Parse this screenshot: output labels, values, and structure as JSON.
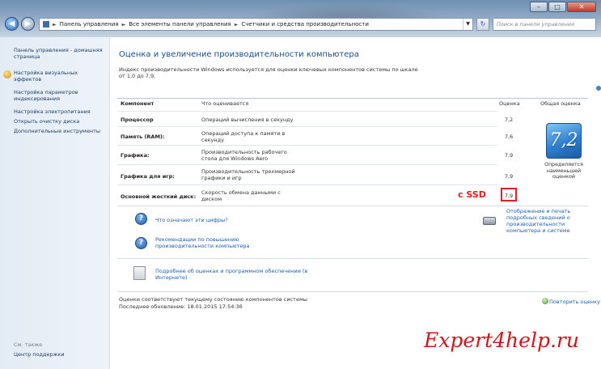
{
  "window": {
    "controls": {
      "minimize": "–",
      "maximize": "□",
      "close": "✕"
    }
  },
  "navigation": {
    "back_icon": "back-arrow-icon",
    "forward_icon": "forward-arrow-icon",
    "breadcrumb": [
      "Панель управления",
      "Все элементы панели управления",
      "Счетчики и средства производительности"
    ],
    "search_placeholder": "Поиск в панели управления"
  },
  "sidebar": {
    "items": [
      {
        "label": "Панель управления - домашняя страница"
      },
      {
        "label": "Настройка визуальных эффектов",
        "icon": "shield-icon"
      },
      {
        "label": "Настройка параметров индексирования"
      },
      {
        "label": "Настройка электропитания"
      },
      {
        "label": "Открыть очистку диска"
      },
      {
        "label": "Дополнительные инструменты"
      }
    ],
    "bottom": {
      "see_also": "См. также",
      "action_center": "Центр поддержки"
    }
  },
  "main": {
    "title": "Оценка и увеличение производительности компьютера",
    "intro": "Индекс производительности Windows используется для оценки ключевых компонентов системы по шкале от 1,0 до 7,9.",
    "headers": {
      "component": "Компонент",
      "what": "Что оценивается",
      "score": "Оценка",
      "overall": "Общая оценка"
    },
    "rows": [
      {
        "component": "Процессор",
        "desc": "Операций вычисления в секунду",
        "score": "7,2"
      },
      {
        "component": "Память (RAM):",
        "desc": "Операций доступа к памяти в секунду",
        "score": "7,6"
      },
      {
        "component": "Графика:",
        "desc": "Производительность рабочего стола для Windows Aero",
        "score": "7,9"
      },
      {
        "component": "Графика для игр:",
        "desc": "Производительность трехмерной графики и игр",
        "score": "7,9"
      },
      {
        "component": "Основной жесткий диск:",
        "desc": "Скорость обмена данными с диском",
        "score": "7,9"
      }
    ],
    "base_score": "7,2",
    "base_score_caption": "Определяется наименьшей оценкой",
    "annotation": "c SSD",
    "details_link": "Отображение и печать подробных сведений о производительности компьютера и системе",
    "links": [
      {
        "text": "Что означают эти цифры?"
      },
      {
        "text": "Рекомендации по повышению производительности компьютера"
      },
      {
        "text": "Подробнее об оценках и программном обеспечении (в Интернете)"
      }
    ],
    "status": [
      "Оценки соответствуют текущему состоянию компонентов системы",
      "Последнее обновление: 18.01.2015 17:54:36"
    ],
    "repeat_link": "Повторить оценку"
  },
  "watermark": "Expert4help.ru"
}
